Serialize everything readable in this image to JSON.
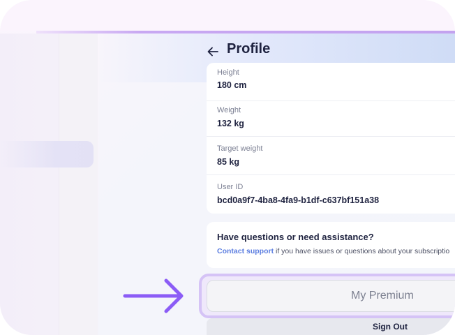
{
  "header": {
    "back_icon": "arrow-left-icon",
    "title": "Profile"
  },
  "profile": {
    "fields": [
      {
        "label": "Height",
        "value": "180 cm"
      },
      {
        "label": "Weight",
        "value": "132 kg"
      },
      {
        "label": "Target weight",
        "value": "85 kg"
      },
      {
        "label": "User ID",
        "value": "bcd0a9f7-4ba8-4fa9-b1df-c637bf151a38"
      }
    ]
  },
  "support": {
    "heading": "Have questions or need assistance?",
    "link_text": "Contact support",
    "text": " if you have issues or questions about your subscriptio"
  },
  "actions": {
    "premium_label": "My Premium",
    "signout_label": "Sign Out"
  },
  "annotation": {
    "arrow_icon": "pointer-arrow-icon",
    "arrow_color": "#8b5cf6",
    "ring_color": "#d5c3f6"
  }
}
